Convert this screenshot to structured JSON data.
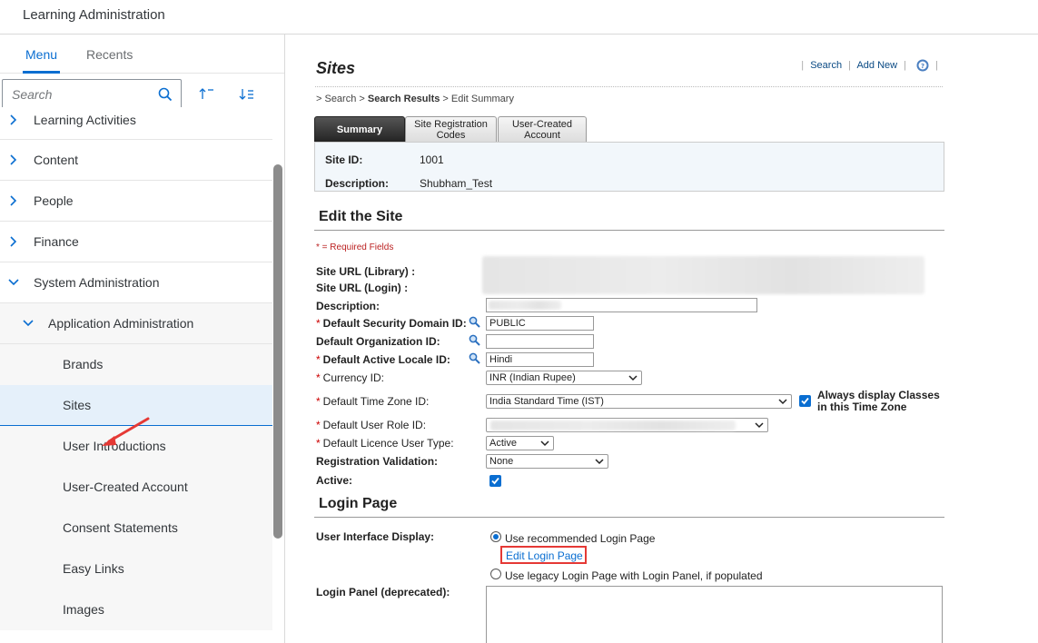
{
  "app": {
    "title": "Learning Administration"
  },
  "sidebar": {
    "tabs": [
      {
        "label": "Menu",
        "active": true
      },
      {
        "label": "Recents",
        "active": false
      }
    ],
    "search_placeholder": "Search",
    "items": [
      {
        "label": "Learning Activities",
        "level": 0
      },
      {
        "label": "Content",
        "level": 0
      },
      {
        "label": "People",
        "level": 0
      },
      {
        "label": "Finance",
        "level": 0
      },
      {
        "label": "System Administration",
        "level": 0,
        "expanded": true
      },
      {
        "label": "Application Administration",
        "level": 1,
        "expanded": true
      },
      {
        "label": "Brands",
        "level": 2
      },
      {
        "label": "Sites",
        "level": 2,
        "selected": true
      },
      {
        "label": "User Introductions",
        "level": 2
      },
      {
        "label": "User-Created Account",
        "level": 2
      },
      {
        "label": "Consent Statements",
        "level": 2
      },
      {
        "label": "Easy Links",
        "level": 2
      },
      {
        "label": "Images",
        "level": 2
      }
    ]
  },
  "main": {
    "title": "Sites",
    "links": {
      "search": "Search",
      "add_new": "Add New"
    },
    "breadcrumb": {
      "prefix": "> Search > ",
      "current": "Search Results",
      "suffix": " > Edit Summary"
    },
    "tabs": [
      "Summary",
      "Site Registration Codes",
      "User-Created Account"
    ],
    "summary": {
      "site_id_label": "Site ID:",
      "site_id": "1001",
      "description_label": "Description:",
      "description": "Shubham_Test"
    },
    "edit_section": {
      "title": "Edit the Site",
      "required_note": "* = Required Fields",
      "fields": {
        "site_url_library": "Site URL (Library) :",
        "site_url_login": "Site URL (Login) :",
        "description": "Description:",
        "security_domain": "Default Security Domain ID:",
        "security_domain_value": "PUBLIC",
        "organization": "Default Organization ID:",
        "locale": "Default Active Locale ID:",
        "locale_value": "Hindi",
        "currency": "Currency ID:",
        "currency_value": "INR (Indian Rupee)",
        "time_zone": "Default Time Zone ID:",
        "time_zone_value": "India Standard Time (IST)",
        "always_display": "Always display Classes in this Time Zone",
        "user_role": "Default User Role ID:",
        "licence_type": "Default Licence User Type:",
        "licence_type_value": "Active",
        "registration_validation": "Registration Validation:",
        "registration_validation_value": "None",
        "active": "Active:"
      }
    },
    "login_section": {
      "title": "Login Page",
      "ui_display_label": "User Interface Display:",
      "option_recommended": "Use recommended Login Page",
      "edit_login_link": "Edit Login Page",
      "option_legacy": "Use legacy Login Page with Login Panel, if populated",
      "login_panel_label": "Login Panel (deprecated):"
    }
  },
  "colors": {
    "accent": "#0a6ed1",
    "required": "#cc0000",
    "highlight": "#e53935"
  }
}
